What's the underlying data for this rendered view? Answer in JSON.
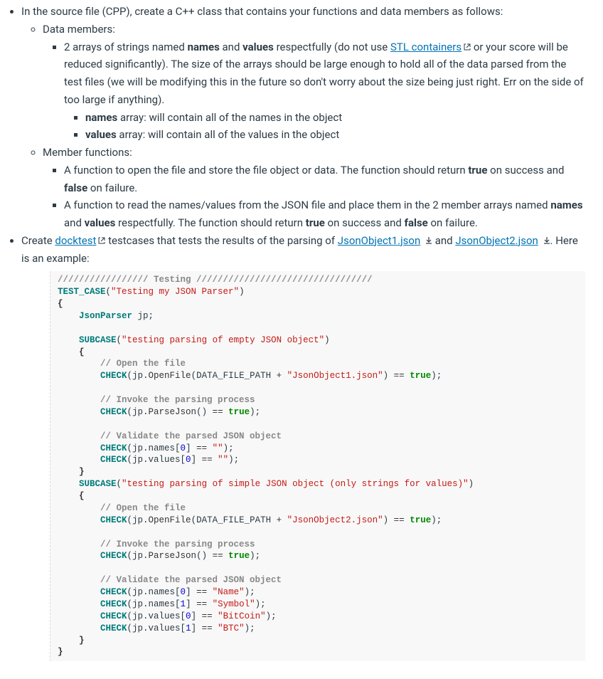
{
  "item1": {
    "intro_pre": "In the source file (CPP), create a C++ class that contains your functions and data members as follows:",
    "data_members_label": "Data members:",
    "arrays_pre": "2 arrays of strings named ",
    "names_b": "names",
    "and1": " and ",
    "values_b": "values",
    "arrays_mid": " respectfully (do not use ",
    "stl_link": "STL containers",
    "arrays_post": " or your score will be reduced significantly). The size of the arrays should be large enough to hold all of the data parsed from the test files (we will be modifying this in the future so don't worry about the size being just right. Err on the side of too large if anything).",
    "names_arr_b": "names",
    "names_arr_txt": " array: will contain all of the names in the object",
    "values_arr_b": "values",
    "values_arr_txt": " array: will contain all of the values in the object",
    "member_funcs_label": "Member functions:",
    "func1_pre": "A function to open the file and store the file object or data. The function should return ",
    "true_b": "true",
    "on_success": " on success and ",
    "false_b": "false",
    "on_failure": " on failure.",
    "func2_pre": "A function to read the names/values from the JSON file and place them in the 2 member arrays named ",
    "func2_mid": " respectfully. The function should return "
  },
  "item2": {
    "pre": "Create ",
    "docktest_link": "docktest",
    "mid1": " testcases that tests the results of the parsing of ",
    "json1_link": "JsonObject1.json",
    "and2": " and ",
    "json2_link": "JsonObject2.json",
    "post": ". Here is an example:"
  },
  "code": {
    "l1": "///////////////// Testing /////////////////////////////////",
    "l2a": "TEST_CASE",
    "l2b": "(",
    "l2c": "\"Testing my JSON Parser\"",
    "l2d": ")",
    "l3": "{",
    "l4a": "    ",
    "l4b": "JsonParser",
    "l4c": " jp;",
    "blank1": "",
    "l5a": "    ",
    "l5b": "SUBCASE",
    "l5c": "(",
    "l5d": "\"testing parsing of empty JSON object\"",
    "l5e": ")",
    "l6": "    {",
    "l7": "        // Open the file",
    "l8a": "        ",
    "l8b": "CHECK",
    "l8c": "(jp.",
    "l8d": "OpenFile",
    "l8e": "(DATA_FILE_PATH ",
    "l8f": "+",
    "l8g": " ",
    "l8h": "\"JsonObject1.json\"",
    "l8i": ") ",
    "l8j": "==",
    "l8k": " ",
    "l8l": "true",
    "l8m": ");",
    "blank2": "",
    "l9": "        // Invoke the parsing process",
    "l10a": "        ",
    "l10b": "CHECK",
    "l10c": "(jp.",
    "l10d": "ParseJson",
    "l10e": "() ",
    "l10f": "==",
    "l10g": " ",
    "l10h": "true",
    "l10i": ");",
    "blank3": "",
    "l11": "        // Validate the parsed JSON object",
    "l12a": "        ",
    "l12b": "CHECK",
    "l12c": "(jp.names[",
    "l12d": "0",
    "l12e": "] ",
    "l12f": "==",
    "l12g": " ",
    "l12h": "\"\"",
    "l12i": ");",
    "l13a": "        ",
    "l13b": "CHECK",
    "l13c": "(jp.values[",
    "l13d": "0",
    "l13e": "] ",
    "l13f": "==",
    "l13g": " ",
    "l13h": "\"\"",
    "l13i": ");",
    "l14": "    }",
    "l15a": "    ",
    "l15b": "SUBCASE",
    "l15c": "(",
    "l15d": "\"testing parsing of simple JSON object (only strings for values)\"",
    "l15e": ")",
    "l16": "    {",
    "l17": "        // Open the file",
    "l18a": "        ",
    "l18b": "CHECK",
    "l18c": "(jp.",
    "l18d": "OpenFile",
    "l18e": "(DATA_FILE_PATH ",
    "l18f": "+",
    "l18g": " ",
    "l18h": "\"JsonObject2.json\"",
    "l18i": ") ",
    "l18j": "==",
    "l18k": " ",
    "l18l": "true",
    "l18m": ");",
    "blank4": "",
    "l19": "        // Invoke the parsing process",
    "l20a": "        ",
    "l20b": "CHECK",
    "l20c": "(jp.",
    "l20d": "ParseJson",
    "l20e": "() ",
    "l20f": "==",
    "l20g": " ",
    "l20h": "true",
    "l20i": ");",
    "blank5": "",
    "l21": "        // Validate the parsed JSON object",
    "l22a": "        ",
    "l22b": "CHECK",
    "l22c": "(jp.names[",
    "l22d": "0",
    "l22e": "] ",
    "l22f": "==",
    "l22g": " ",
    "l22h": "\"Name\"",
    "l22i": ");",
    "l23a": "        ",
    "l23b": "CHECK",
    "l23c": "(jp.names[",
    "l23d": "1",
    "l23e": "] ",
    "l23f": "==",
    "l23g": " ",
    "l23h": "\"Symbol\"",
    "l23i": ");",
    "l24a": "        ",
    "l24b": "CHECK",
    "l24c": "(jp.values[",
    "l24d": "0",
    "l24e": "] ",
    "l24f": "==",
    "l24g": " ",
    "l24h": "\"BitCoin\"",
    "l24i": ");",
    "l25a": "        ",
    "l25b": "CHECK",
    "l25c": "(jp.values[",
    "l25d": "1",
    "l25e": "] ",
    "l25f": "==",
    "l25g": " ",
    "l25h": "\"BTC\"",
    "l25i": ");",
    "l26": "    }",
    "l27": "}"
  }
}
